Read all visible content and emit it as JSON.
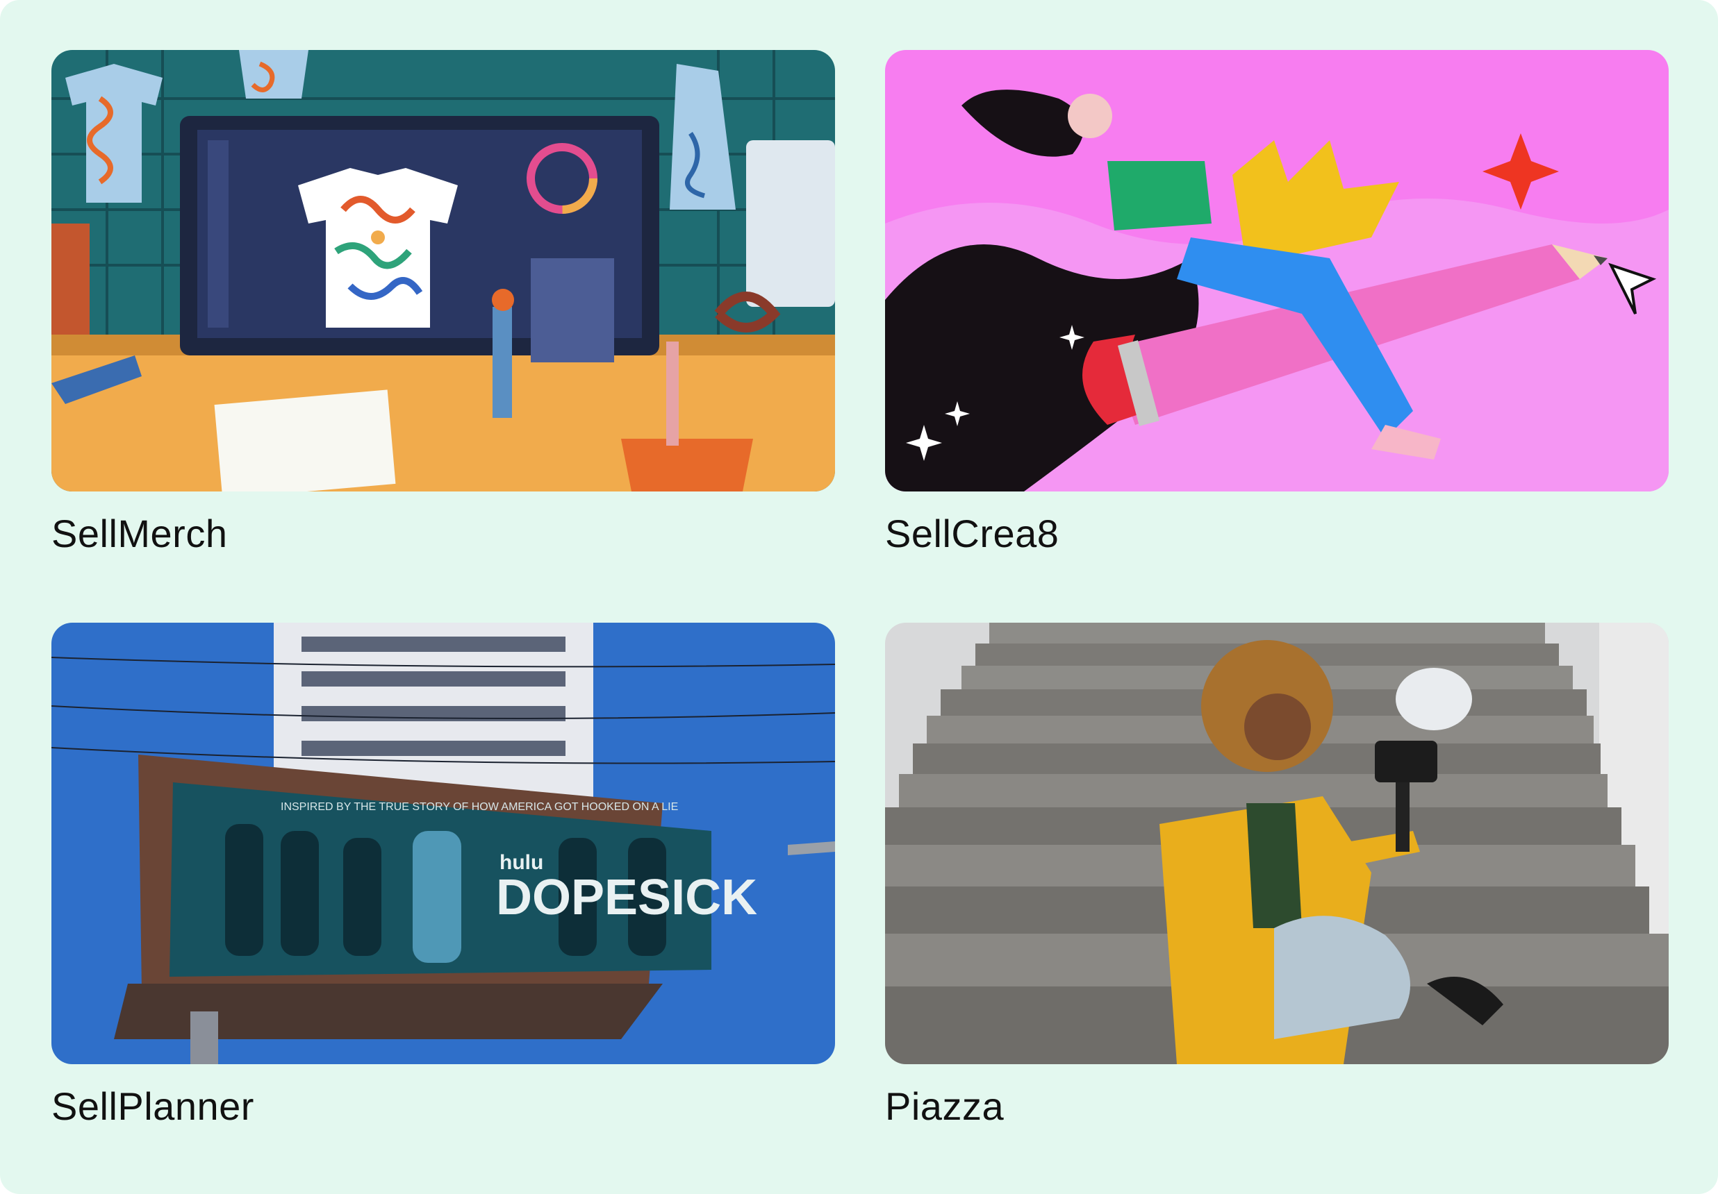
{
  "cards": [
    {
      "label": "SellMerch",
      "image": "merch-design-illustration"
    },
    {
      "label": "SellCrea8",
      "image": "pencil-rider-illustration"
    },
    {
      "label": "SellPlanner",
      "image": "billboard-photo"
    },
    {
      "label": "Piazza",
      "image": "vlogger-on-stairs-photo"
    }
  ],
  "billboard": {
    "brand": "hulu",
    "headline": "DOPESICK",
    "tagline": "INSPIRED BY THE TRUE STORY OF HOW AMERICA GOT HOOKED ON A LIE"
  },
  "colors": {
    "background": "#e3f8ef",
    "label_text": "#111111",
    "crea8_pink": "#f77df0",
    "sky_blue": "#2f6fc9"
  }
}
